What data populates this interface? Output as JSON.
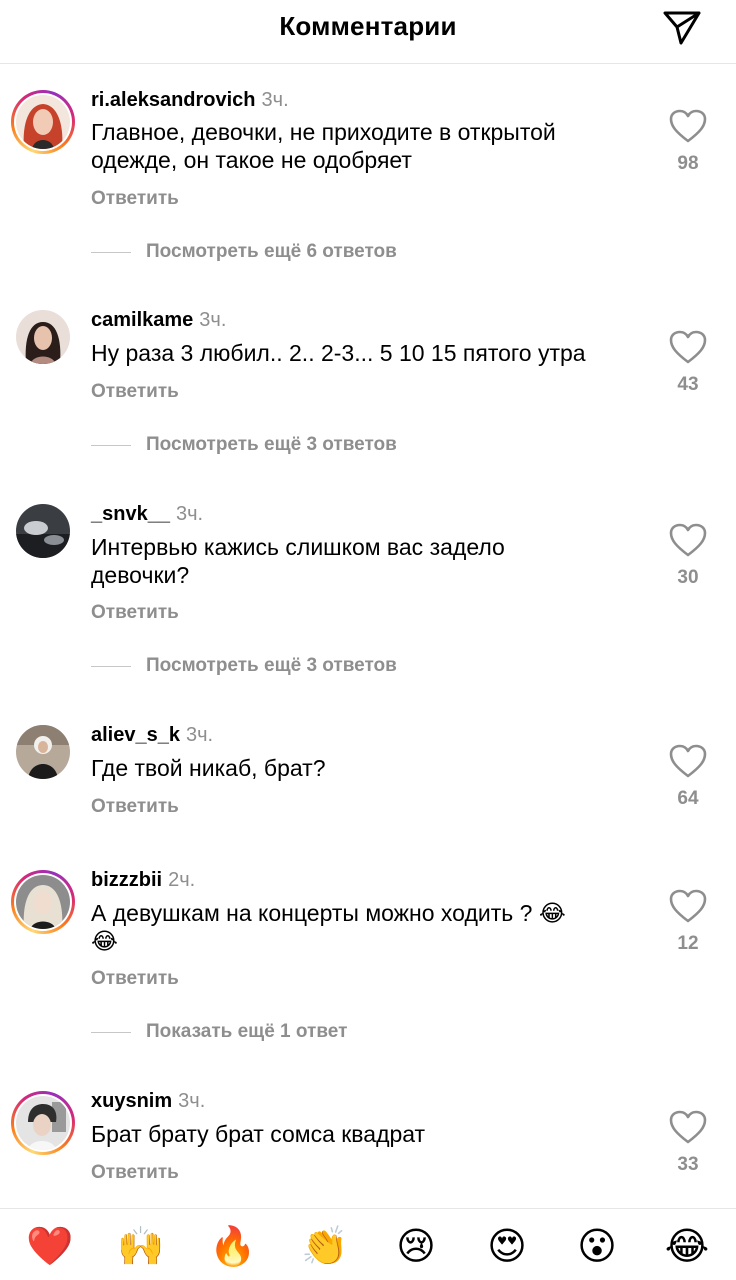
{
  "header": {
    "title": "Комментарии",
    "share_icon": "paper-plane-icon"
  },
  "comments": [
    {
      "username": "ri.aleksandrovich",
      "time": "3ч.",
      "text_lines": [
        "Главное, девочки, не приходите в открытой",
        "одежде, он такое не одобряет"
      ],
      "reply_label": "Ответить",
      "likes": "98",
      "more_replies": "Посмотреть ещё 6 ответов",
      "has_story": true
    },
    {
      "username": "camilkame",
      "time": "3ч.",
      "text_lines": [
        "Ну раза 3 любил.. 2.. 2-3... 5 10 15 пятого утра"
      ],
      "reply_label": "Ответить",
      "likes": "43",
      "more_replies": "Посмотреть ещё 3 ответов",
      "has_story": false
    },
    {
      "username": "_snvk__",
      "time": "3ч.",
      "text_lines": [
        "Интервью кажись слишком вас задело",
        "девочки?"
      ],
      "reply_label": "Ответить",
      "likes": "30",
      "more_replies": "Посмотреть ещё 3 ответов",
      "has_story": false
    },
    {
      "username": "aliev_s_k",
      "time": "3ч.",
      "text_lines": [
        "Где твой никаб, брат?"
      ],
      "reply_label": "Ответить",
      "likes": "64",
      "more_replies": "",
      "has_story": false
    },
    {
      "username": "bizzzbii",
      "time": "2ч.",
      "text_lines": [
        "А девушкам на концерты можно ходить ? 😂",
        "😂"
      ],
      "reply_label": "Ответить",
      "likes": "12",
      "more_replies": "Показать ещё 1 ответ",
      "has_story": true
    },
    {
      "username": "xuysnim",
      "time": "3ч.",
      "text_lines": [
        "Брат брату брат сомса квадрат"
      ],
      "reply_label": "Ответить",
      "likes": "33",
      "more_replies": "",
      "has_story": true
    }
  ],
  "emoji_bar": [
    "❤️",
    "🙌",
    "🔥",
    "👏",
    "😢",
    "😍",
    "😮",
    "😂"
  ],
  "colors": {
    "text_primary": "#000000",
    "text_secondary": "#8e8e8e",
    "divider": "#e6e6e6"
  }
}
